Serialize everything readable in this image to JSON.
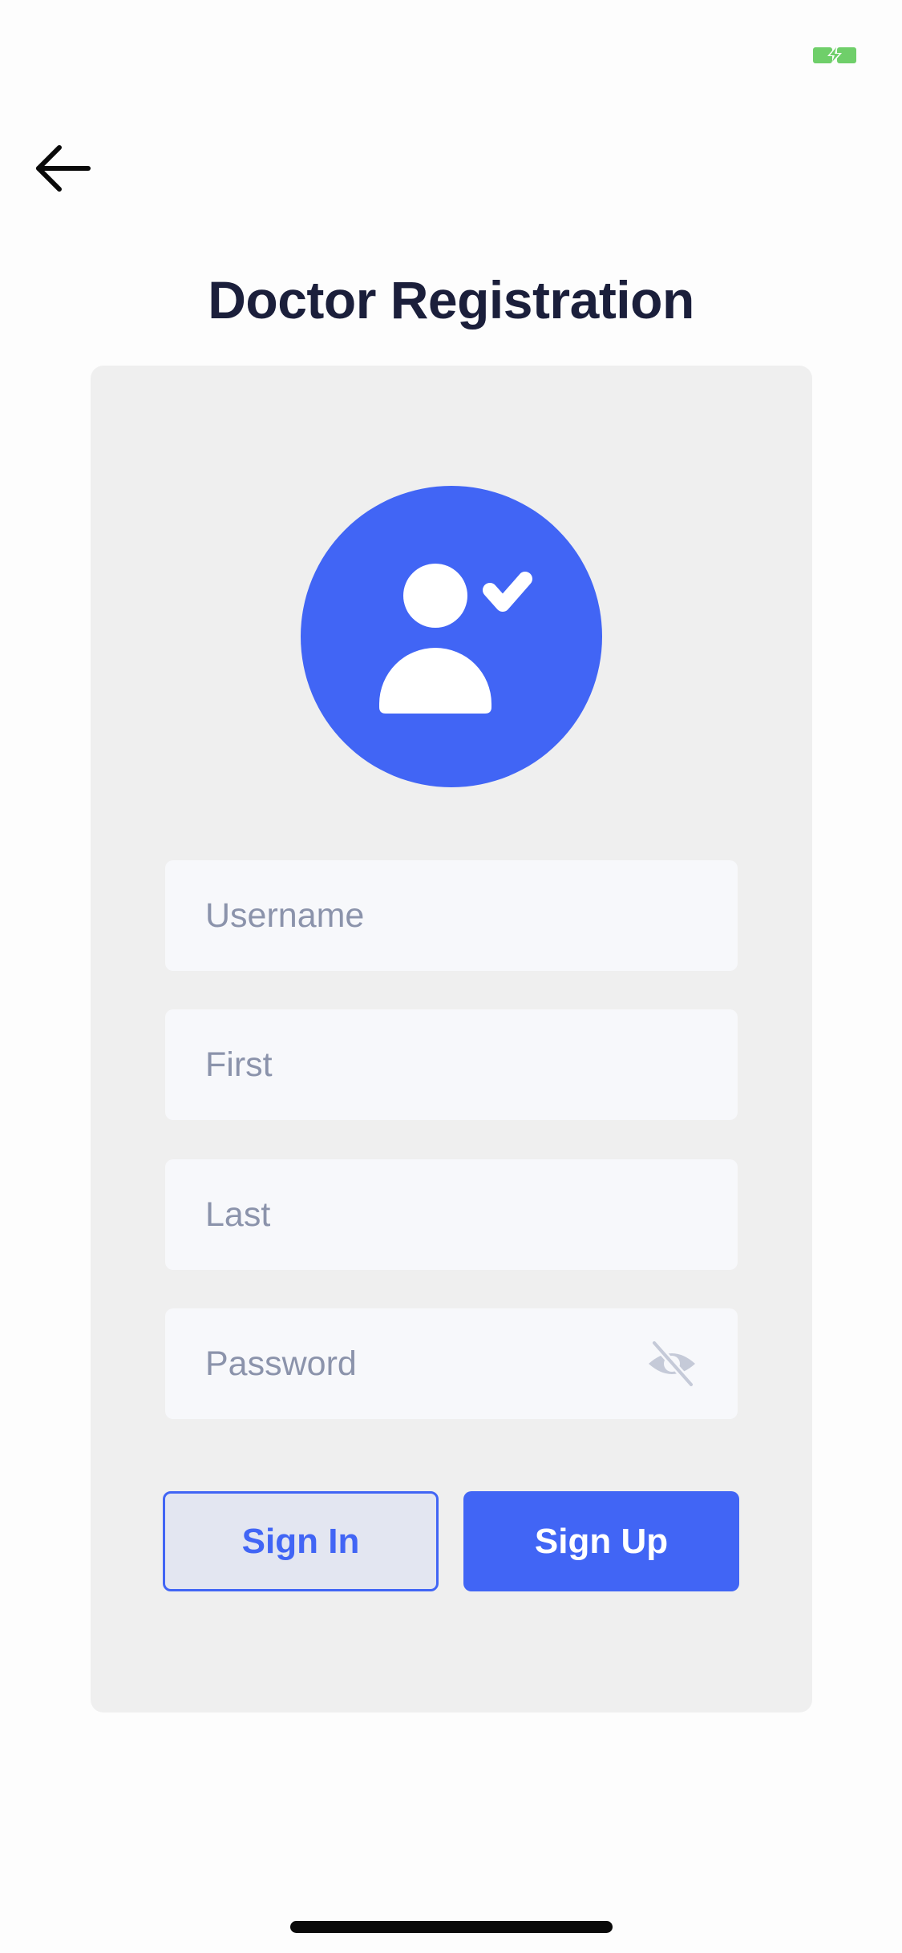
{
  "colors": {
    "primary": "#4165f5",
    "title": "#1b1f3b",
    "card_background": "#efefef",
    "field_background": "#f7f8fb",
    "placeholder": "#8b93ab",
    "battery": "#6fcf6a"
  },
  "status_bar": {
    "battery_icon": "battery-charging-icon"
  },
  "header": {
    "back_icon": "arrow-left-icon",
    "title": "Doctor Registration"
  },
  "form": {
    "avatar_icon": "user-check-icon",
    "fields": {
      "username": {
        "placeholder": "Username",
        "value": ""
      },
      "first": {
        "placeholder": "First",
        "value": ""
      },
      "last": {
        "placeholder": "Last",
        "value": ""
      },
      "password": {
        "placeholder": "Password",
        "value": "",
        "toggle_icon": "eye-off-icon"
      }
    },
    "buttons": {
      "sign_in": "Sign In",
      "sign_up": "Sign Up"
    }
  }
}
